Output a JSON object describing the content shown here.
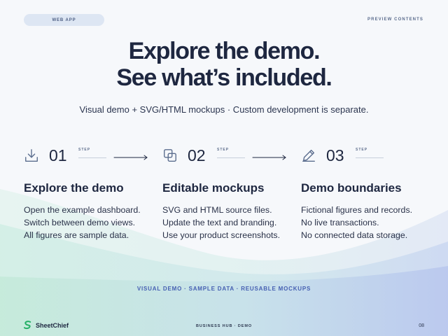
{
  "header": {
    "pill_label": "WEB APP",
    "right_label": "PREVIEW CONTENTS"
  },
  "hero": {
    "title_line1": "Explore the demo.",
    "title_line2": "See what’s included.",
    "subtitle": "Visual demo + SVG/HTML mockups · Custom development is separate."
  },
  "steps": [
    {
      "number": "01",
      "tag": "STEP",
      "icon": "download-icon",
      "title": "Explore the demo",
      "lines": [
        "Open the example dashboard.",
        "Switch between demo views.",
        "All figures are sample data."
      ]
    },
    {
      "number": "02",
      "tag": "STEP",
      "icon": "copy-icon",
      "title": "Editable mockups",
      "lines": [
        "SVG and HTML source files.",
        "Update the text and branding.",
        "Use your product screenshots."
      ]
    },
    {
      "number": "03",
      "tag": "STEP",
      "icon": "edit-icon",
      "title": "Demo boundaries",
      "lines": [
        "Fictional figures and records.",
        "No live transactions.",
        "No connected data storage."
      ]
    }
  ],
  "tagline": "VISUAL DEMO · SAMPLE DATA · REUSABLE MOCKUPS",
  "footer": {
    "brand_name": "SheetChief",
    "brand_icon": "sheetchief-logo-icon",
    "center_label": "BUSINESS HUB · DEMO",
    "page_number": "08"
  },
  "colors": {
    "background": "#f6f8fb",
    "heading": "#1e2740",
    "accent": "#4660b2",
    "icon": "#5b6d8e",
    "brand_green": "#25b066"
  }
}
